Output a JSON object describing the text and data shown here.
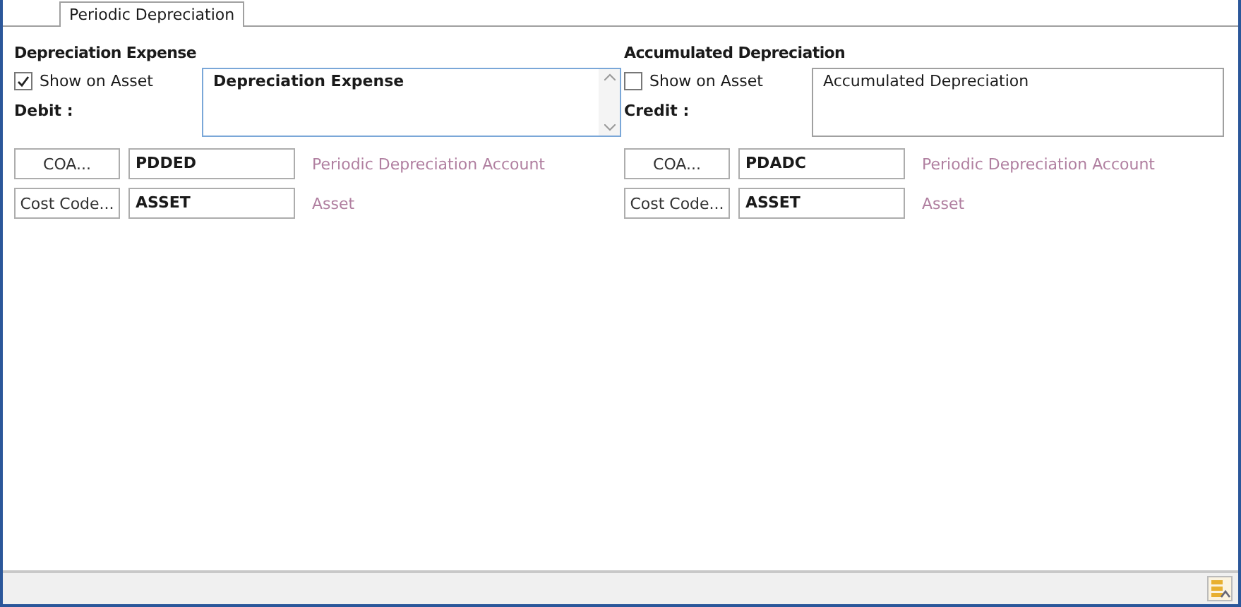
{
  "tabs": [
    {
      "label": "Periodic Depreciation",
      "selected": true
    }
  ],
  "sections": [
    {
      "heading": "Depreciation Expense",
      "show_on_asset": {
        "label": "Show on Asset",
        "checked": true
      },
      "side_label": "Debit :",
      "memo": {
        "value": "Depreciation Expense",
        "focused": true,
        "scrollbar": true
      },
      "rows": [
        {
          "button": "COA...",
          "code": "PDDED",
          "description": "Periodic Depreciation Account"
        },
        {
          "button": "Cost Code...",
          "code": "ASSET",
          "description": "Asset"
        }
      ]
    },
    {
      "heading": "Accumulated Depreciation",
      "show_on_asset": {
        "label": "Show on Asset",
        "checked": false
      },
      "side_label": "Credit :",
      "memo": {
        "value": "Accumulated Depreciation",
        "focused": false,
        "scrollbar": false
      },
      "rows": [
        {
          "button": "COA...",
          "code": "PDADC",
          "description": "Periodic Depreciation Account"
        },
        {
          "button": "Cost Code...",
          "code": "ASSET",
          "description": "Asset"
        }
      ]
    }
  ]
}
